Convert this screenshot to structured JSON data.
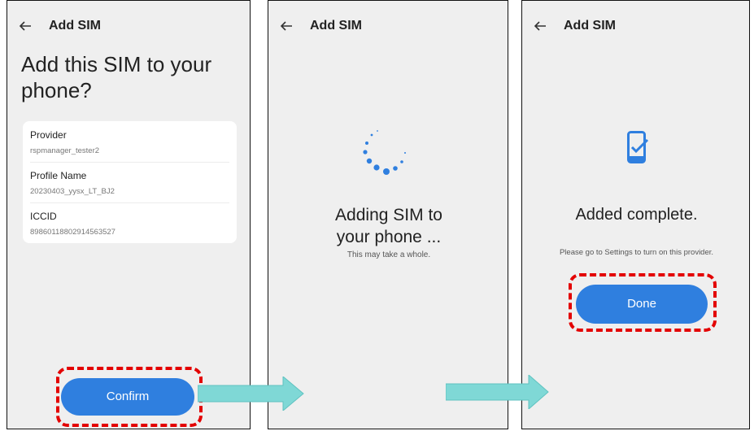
{
  "screens": [
    {
      "title": "Add SIM",
      "heading": "Add this SIM to your phone?",
      "details": [
        {
          "label": "Provider",
          "value": "rspmanager_tester2"
        },
        {
          "label": "Profile Name",
          "value": "20230403_yysx_LT_BJ2"
        },
        {
          "label": "ICCID",
          "value": "89860118802914563527"
        }
      ],
      "confirm_label": "Confirm"
    },
    {
      "title": "Add SIM",
      "status_title_line1": "Adding SIM to",
      "status_title_line2": "your phone ...",
      "status_subtitle": "This may take a whole."
    },
    {
      "title": "Add SIM",
      "status_title": "Added complete.",
      "status_subtitle": "Please go to Settings to turn on this provider.",
      "done_label": "Done"
    }
  ],
  "icons": {
    "back": "arrow-left-icon",
    "loading": "loading-spinner-icon",
    "complete": "phone-check-icon",
    "flow": "flow-arrow-icon"
  },
  "colors": {
    "accent": "#2f7fdf",
    "highlight": "#e30000",
    "arrow": "#7fd8d6",
    "screen_background": "#efefef"
  }
}
